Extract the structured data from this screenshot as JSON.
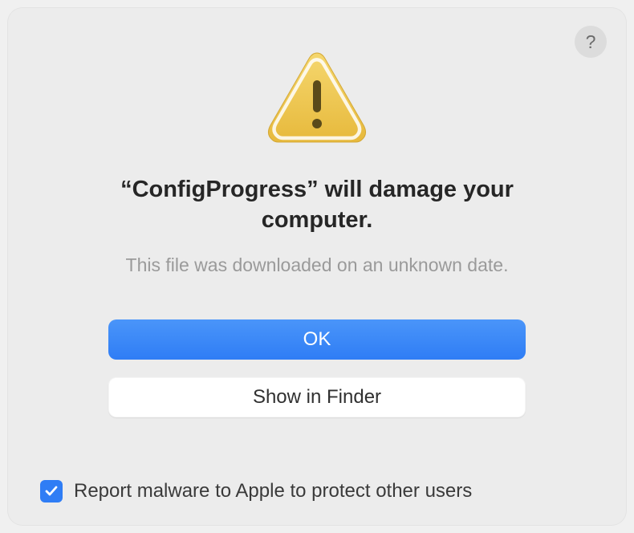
{
  "dialog": {
    "title": "“ConfigProgress” will damage your computer.",
    "subtitle": "This file was downloaded on an unknown date.",
    "help_label": "?",
    "buttons": {
      "ok_label": "OK",
      "show_in_finder_label": "Show in Finder"
    },
    "checkbox": {
      "checked": true,
      "label": "Report malware to Apple to protect other users"
    }
  },
  "icons": {
    "warning": "warning-triangle",
    "help": "question-mark",
    "checkmark": "checkmark"
  }
}
